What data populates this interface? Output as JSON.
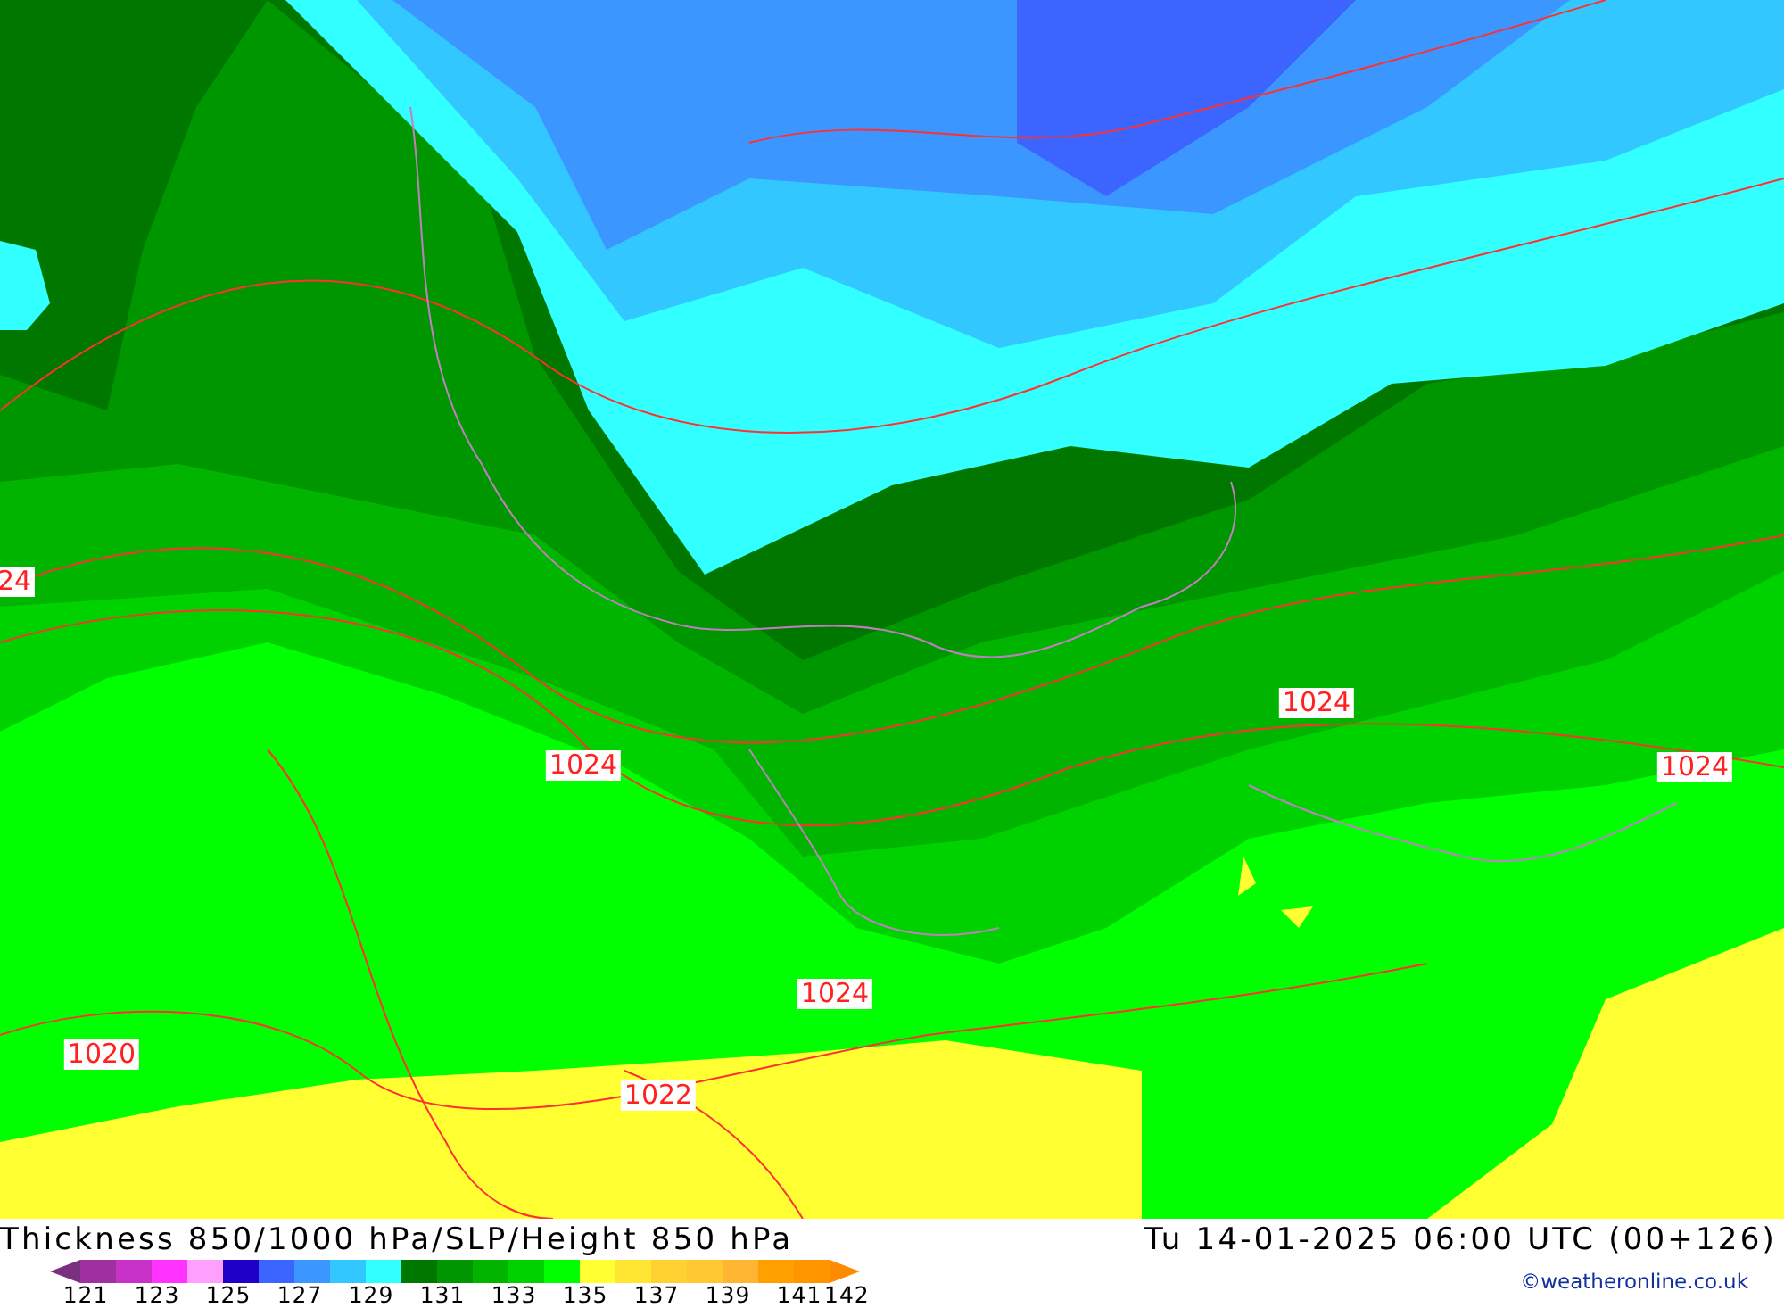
{
  "map": {
    "isobar_labels": [
      {
        "text": "24"
      },
      {
        "text": "1024"
      },
      {
        "text": "1024"
      },
      {
        "text": "1024"
      },
      {
        "text": "1024"
      },
      {
        "text": "1020"
      },
      {
        "text": "1022"
      }
    ]
  },
  "title": {
    "left": "Thickness 850/1000 hPa/SLP/Height 850 hPa",
    "right": "Tu 14-01-2025 06:00 UTC (00+126)"
  },
  "legend": {
    "swatches": [
      {
        "kind": "arrow-left",
        "color": "#7a3080"
      },
      {
        "kind": "swatch",
        "color": "#a030a0"
      },
      {
        "kind": "swatch",
        "color": "#c832c8"
      },
      {
        "kind": "swatch",
        "color": "#ff32ff"
      },
      {
        "kind": "swatch",
        "color": "#ffa0ff"
      },
      {
        "kind": "swatch",
        "color": "#1e00c8"
      },
      {
        "kind": "swatch",
        "color": "#3c64ff"
      },
      {
        "kind": "swatch",
        "color": "#3c96ff"
      },
      {
        "kind": "swatch",
        "color": "#32c8ff"
      },
      {
        "kind": "swatch",
        "color": "#32ffff"
      },
      {
        "kind": "swatch",
        "color": "#007800"
      },
      {
        "kind": "swatch",
        "color": "#009600"
      },
      {
        "kind": "swatch",
        "color": "#00b400"
      },
      {
        "kind": "swatch",
        "color": "#00d200"
      },
      {
        "kind": "swatch",
        "color": "#00ff00"
      },
      {
        "kind": "swatch",
        "color": "#ffff32"
      },
      {
        "kind": "swatch",
        "color": "#ffe632"
      },
      {
        "kind": "swatch",
        "color": "#ffd232"
      },
      {
        "kind": "swatch",
        "color": "#ffc832"
      },
      {
        "kind": "swatch",
        "color": "#ffb432"
      },
      {
        "kind": "swatch",
        "color": "#ffa000"
      },
      {
        "kind": "swatch",
        "color": "#ff9600"
      },
      {
        "kind": "arrow-right",
        "color": "#ff8c00"
      }
    ],
    "labels": [
      "121",
      "123",
      "125",
      "127",
      "129",
      "131",
      "133",
      "135",
      "137",
      "139",
      "141",
      "142"
    ]
  },
  "copyright": "©weatheronline.co.uk"
}
